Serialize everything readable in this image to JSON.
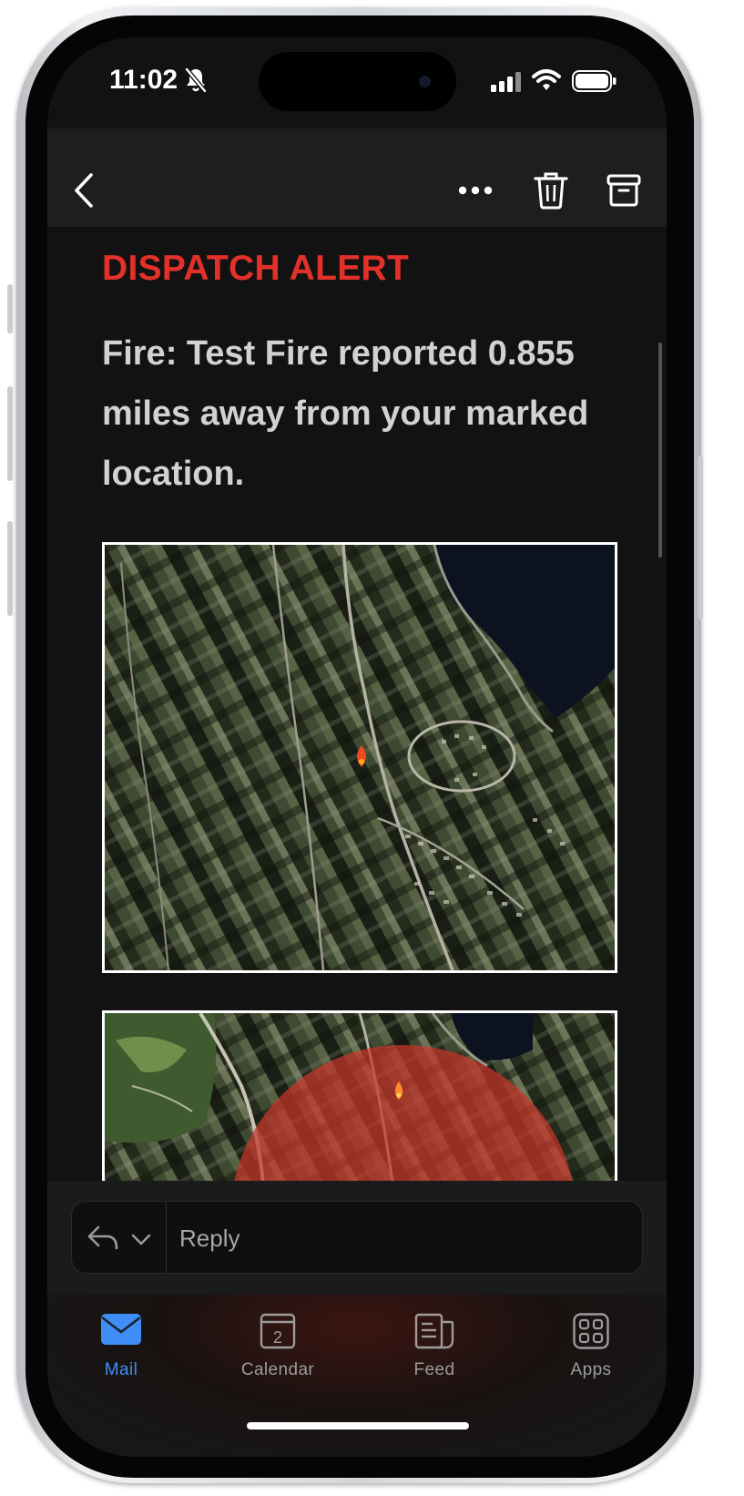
{
  "status_bar": {
    "time": "11:02"
  },
  "email": {
    "heading": "DISPATCH ALERT",
    "message": "Fire: Test Fire reported 0.855 miles away from your marked location."
  },
  "reply": {
    "placeholder": "Reply"
  },
  "tab_bar": {
    "tabs": [
      {
        "label": "Mail",
        "icon": "mail-icon",
        "active": true
      },
      {
        "label": "Calendar",
        "icon": "calendar-icon",
        "badge": "2"
      },
      {
        "label": "Feed",
        "icon": "feed-icon"
      },
      {
        "label": "Apps",
        "icon": "apps-icon"
      }
    ]
  },
  "colors": {
    "alert_red": "#e3312a",
    "accent_blue": "#3f8ef5",
    "background": "#121212",
    "radius_overlay": "#c8362b"
  }
}
